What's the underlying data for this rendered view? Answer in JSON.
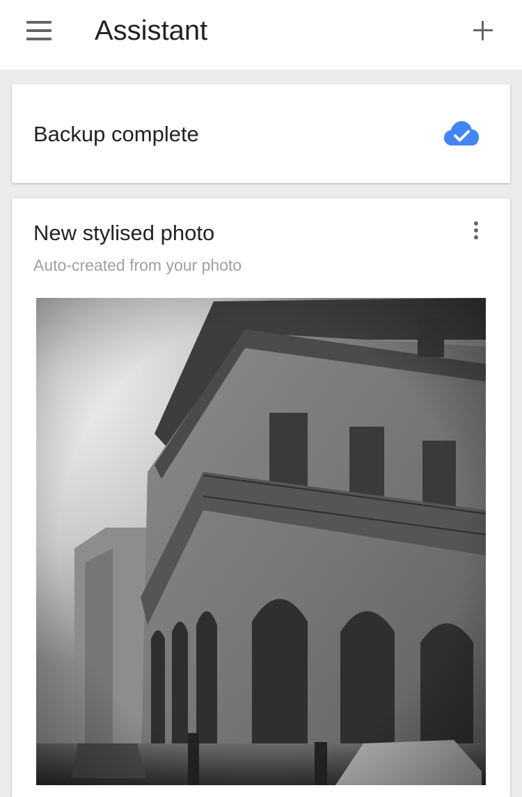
{
  "app_bar": {
    "title": "Assistant",
    "menu_icon": "hamburger-menu-icon",
    "add_icon": "plus-icon"
  },
  "cards": {
    "backup": {
      "text": "Backup complete",
      "icon": "cloud-done-icon",
      "icon_color": "#4285f4"
    },
    "stylised_photo": {
      "title": "New stylised photo",
      "subtitle": "Auto-created from your photo",
      "more_icon": "more-vert-icon",
      "image": "black-and-white photo of an old colonial building with arched arcade and balcony on a street corner"
    }
  },
  "colors": {
    "background": "#ececec",
    "card": "#ffffff",
    "accent": "#4285f4",
    "text_primary": "#222222",
    "text_secondary": "#9e9e9e"
  }
}
